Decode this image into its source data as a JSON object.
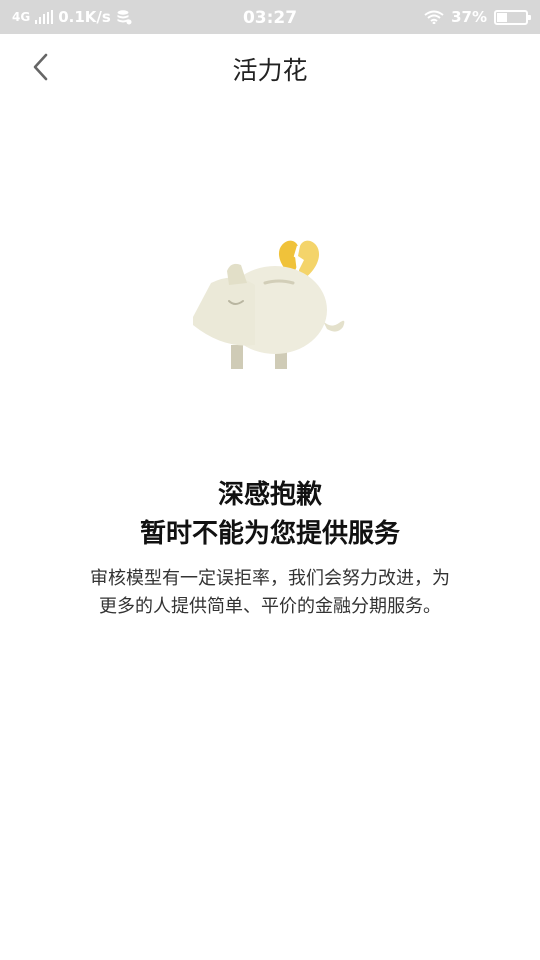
{
  "status_bar": {
    "network_type": "4G",
    "net_speed": "0.1K/s",
    "time": "03:27",
    "battery_percent": "37%",
    "battery_level": 0.37
  },
  "header": {
    "title": "活力花"
  },
  "illustration": {
    "icon": "broken-heart-piggy-bank-icon",
    "heart_color": "#f2c94c",
    "pig_color": "#eeecdd"
  },
  "message": {
    "headline_line1": "深感抱歉",
    "headline_line2": "暂时不能为您提供服务",
    "description_line1": "审核模型有一定误拒率，我们会努力改进，为",
    "description_line2": "更多的人提供简单、平价的金融分期服务。"
  }
}
